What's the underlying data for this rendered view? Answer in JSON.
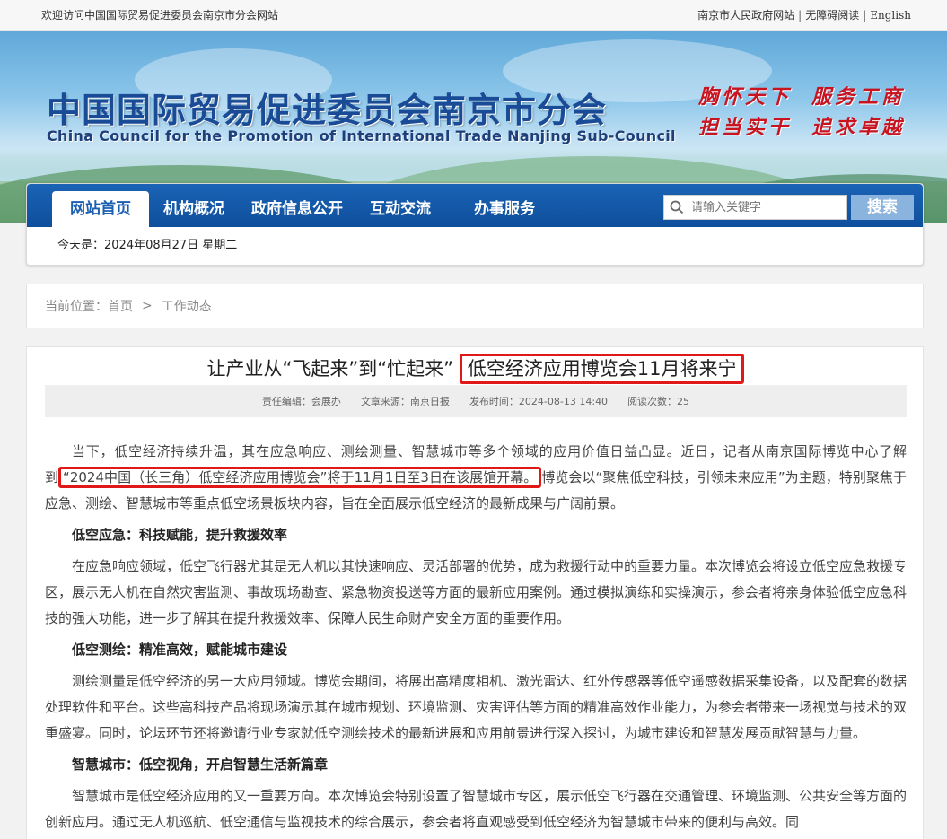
{
  "topbar": {
    "welcome": "欢迎访问中国国际贸易促进委员会南京市分会网站",
    "links": [
      "南京市人民政府网站",
      "无障碍阅读",
      "English"
    ]
  },
  "banner": {
    "title_cn": "中国国际贸易促进委员会南京市分会",
    "title_en": "China Council for the Promotion of International Trade Nanjing Sub-Council",
    "slogans": [
      "胸怀天下",
      "服务工商",
      "担当实干",
      "追求卓越"
    ]
  },
  "nav": {
    "items": [
      "网站首页",
      "机构概况",
      "政府信息公开",
      "互动交流",
      "办事服务"
    ],
    "search_placeholder": "请输入关键字",
    "search_button": "搜索"
  },
  "date": "今天是：2024年08月27日 星期二",
  "breadcrumb": {
    "label": "当前位置：",
    "items": [
      "首页",
      "工作动态"
    ],
    "separator": ">"
  },
  "article": {
    "title_plain": "让产业从“飞起来”到“忙起来”",
    "title_highlight": "低空经济应用博览会11月将来宁",
    "meta": {
      "editor": "责任编辑：会展办",
      "source": "文章来源：南京日报",
      "time": "发布时间：2024-08-13 14:40",
      "views": "阅读次数：25"
    },
    "intro_before": "当下，低空经济持续升温，其在应急响应、测绘测量、智慧城市等多个领域的应用价值日益凸显。近日，记者从南京国际博览中心了解到",
    "intro_highlight": "“2024中国（长三角）低空经济应用博览会”将于11月1日至3日在该展馆开幕。",
    "intro_after": "博览会以“聚焦低空科技，引领未来应用”为主题，特别聚焦于应急、测绘、智慧城市等重点低空场景板块内容，旨在全面展示低空经济的最新成果与广阔前景。",
    "sections": [
      {
        "heading": "低空应急：科技赋能，提升救援效率",
        "text": "在应急响应领域，低空飞行器尤其是无人机以其快速响应、灵活部署的优势，成为救援行动中的重要力量。本次博览会将设立低空应急救援专区，展示无人机在自然灾害监测、事故现场勘查、紧急物资投送等方面的最新应用案例。通过模拟演练和实操演示，参会者将亲身体验低空应急科技的强大功能，进一步了解其在提升救援效率、保障人民生命财产安全方面的重要作用。"
      },
      {
        "heading": "低空测绘：精准高效，赋能城市建设",
        "text": "测绘测量是低空经济的另一大应用领域。博览会期间，将展出高精度相机、激光雷达、红外传感器等低空遥感数据采集设备，以及配套的数据处理软件和平台。这些高科技产品将现场演示其在城市规划、环境监测、灾害评估等方面的精准高效作业能力，为参会者带来一场视觉与技术的双重盛宴。同时，论坛环节还将邀请行业专家就低空测绘技术的最新进展和应用前景进行深入探讨，为城市建设和智慧发展贡献智慧与力量。"
      },
      {
        "heading": "智慧城市：低空视角，开启智慧生活新篇章",
        "text": "智慧城市是低空经济应用的又一重要方向。本次博览会特别设置了智慧城市专区，展示低空飞行器在交通管理、环境监测、公共安全等方面的创新应用。通过无人机巡航、低空通信与监视技术的综合展示，参会者将直观感受到低空经济为智慧城市带来的便利与高效。同"
      }
    ]
  }
}
